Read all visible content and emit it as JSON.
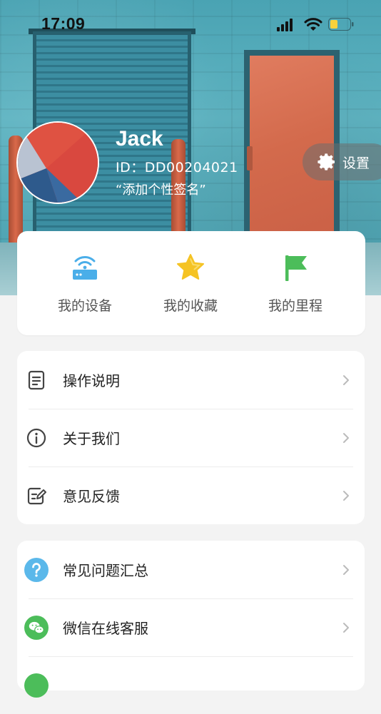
{
  "status_bar": {
    "time": "17:09"
  },
  "profile": {
    "name": "Jack",
    "id_line": "ID：DD00204021",
    "signature": "“添加个性签名”"
  },
  "settings": {
    "label": "设置"
  },
  "quick_actions": [
    {
      "label": "我的设备",
      "icon": "router-icon",
      "color": "#4aaee9"
    },
    {
      "label": "我的收藏",
      "icon": "star-icon",
      "color": "#f5c324"
    },
    {
      "label": "我的里程",
      "icon": "flag-icon",
      "color": "#4cbd5a"
    }
  ],
  "menu_group_1": [
    {
      "label": "操作说明",
      "icon": "document-icon"
    },
    {
      "label": "关于我们",
      "icon": "info-icon"
    },
    {
      "label": "意见反馈",
      "icon": "edit-note-icon"
    }
  ],
  "menu_group_2": [
    {
      "label": "常见问题汇总",
      "icon": "question-icon",
      "color": "#5bb8ea"
    },
    {
      "label": "微信在线客服",
      "icon": "wechat-icon",
      "color": "#4cbd5a"
    }
  ],
  "colors": {
    "accent_blue": "#4aaee9",
    "accent_yellow": "#f5c324",
    "accent_green": "#4cbd5a"
  }
}
